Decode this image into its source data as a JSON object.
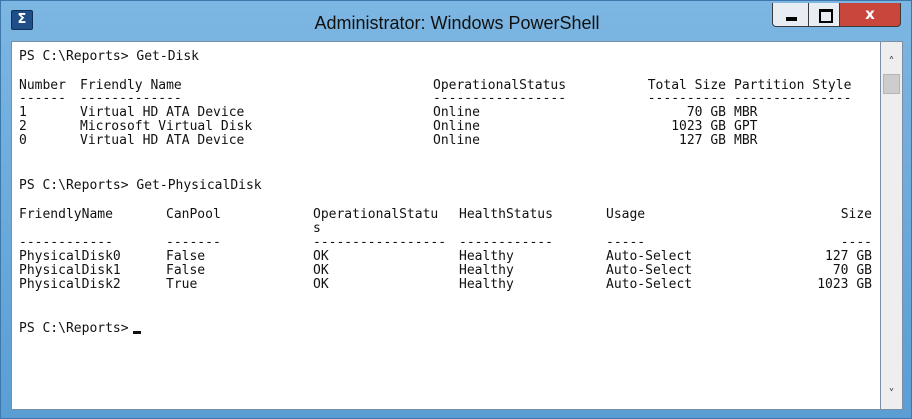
{
  "window": {
    "title": "Administrator: Windows PowerShell",
    "icon_glyph": "Σ",
    "controls": {
      "minimize": "minimize-icon",
      "maximize": "maximize-icon",
      "close": "close-icon",
      "close_glyph": "x"
    }
  },
  "console": {
    "prompt1": "PS C:\\Reports> Get-Disk",
    "disk_headers": {
      "number": "Number",
      "friendly_name": "Friendly Name",
      "status": "OperationalStatus",
      "size": "Total Size",
      "partition": "Partition Style"
    },
    "disk_underlines": {
      "number": "------",
      "friendly_name": "-------------",
      "status": "-----------------",
      "size": "----------",
      "partition": "---------------"
    },
    "disks": [
      {
        "number": "1",
        "friendly_name": "Virtual HD ATA Device",
        "status": "Online",
        "size": "70 GB",
        "partition": "MBR"
      },
      {
        "number": "2",
        "friendly_name": "Microsoft Virtual Disk",
        "status": "Online",
        "size": "1023 GB",
        "partition": "GPT"
      },
      {
        "number": "0",
        "friendly_name": "Virtual HD ATA Device",
        "status": "Online",
        "size": "127 GB",
        "partition": "MBR"
      }
    ],
    "prompt2": "PS C:\\Reports> Get-PhysicalDisk",
    "pd_headers": {
      "friendly_name": "FriendlyName",
      "can_pool": "CanPool",
      "status_a": "OperationalStatu",
      "status_b": "s",
      "health": "HealthStatus",
      "usage": "Usage",
      "size": "Size"
    },
    "pd_underlines": {
      "friendly_name": "------------",
      "can_pool": "-------",
      "status": "-----------------",
      "health": "------------",
      "usage": "-----",
      "size": "----"
    },
    "physical_disks": [
      {
        "friendly_name": "PhysicalDisk0",
        "can_pool": "False",
        "status": "OK",
        "health": "Healthy",
        "usage": "Auto-Select",
        "size": "127 GB"
      },
      {
        "friendly_name": "PhysicalDisk1",
        "can_pool": "False",
        "status": "OK",
        "health": "Healthy",
        "usage": "Auto-Select",
        "size": "70 GB"
      },
      {
        "friendly_name": "PhysicalDisk2",
        "can_pool": "True",
        "status": "OK",
        "health": "Healthy",
        "usage": "Auto-Select",
        "size": "1023 GB"
      }
    ],
    "prompt3": "PS C:\\Reports>"
  },
  "scrollbar": {
    "up": "˄",
    "down": "˅"
  }
}
